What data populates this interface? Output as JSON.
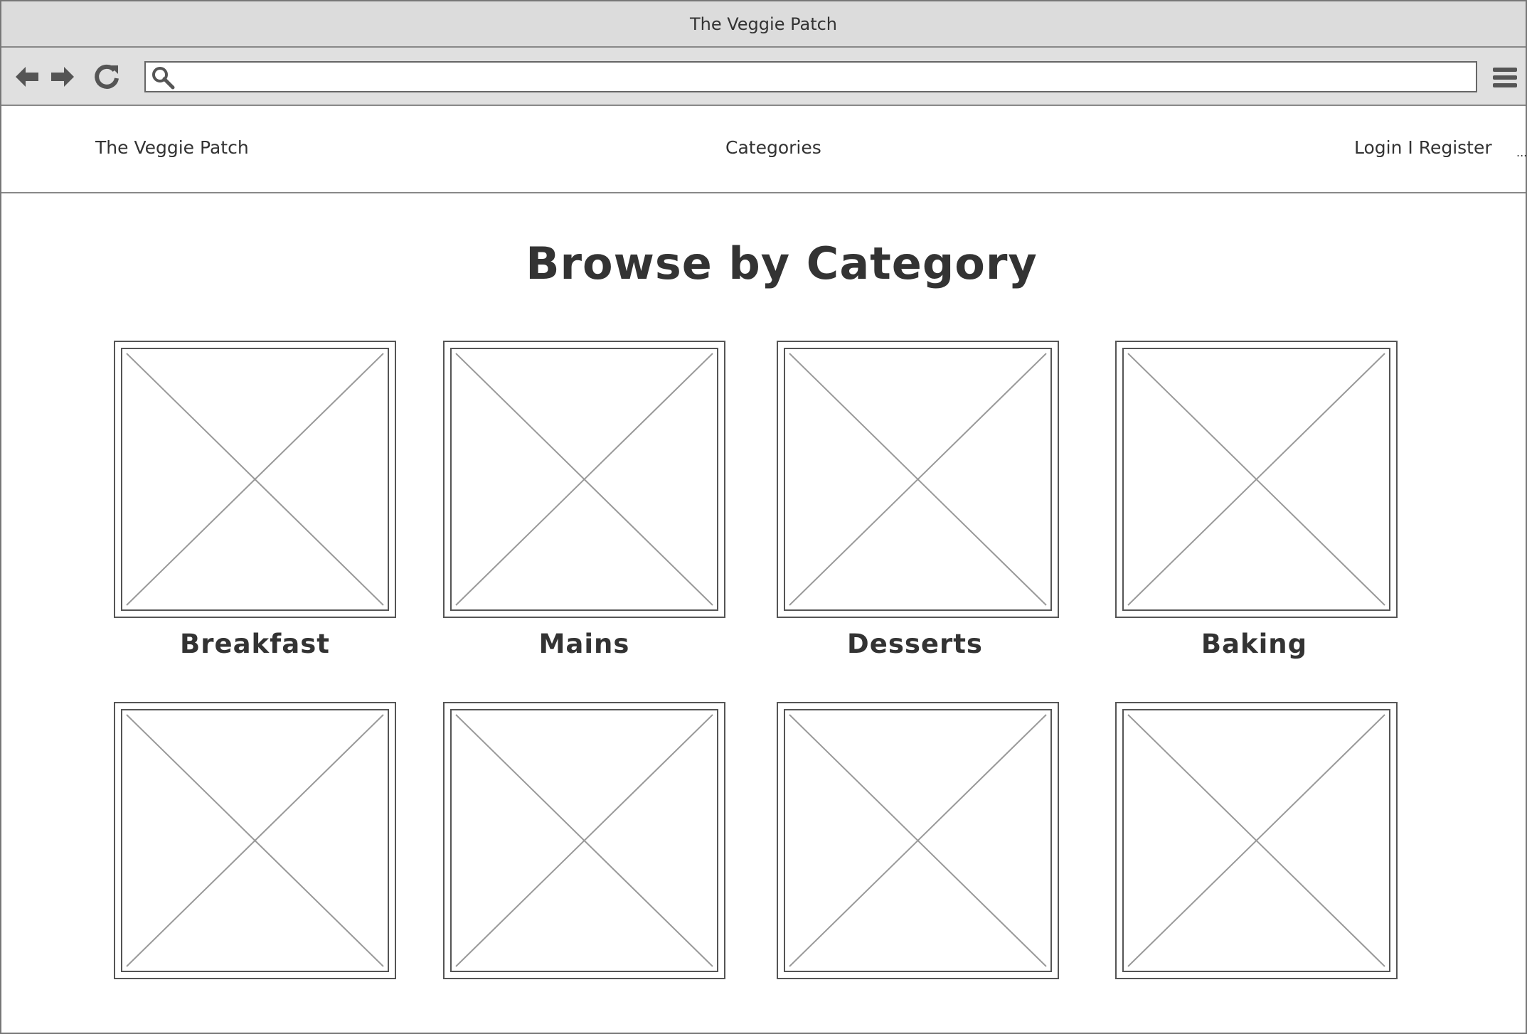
{
  "window": {
    "title": "The Veggie Patch"
  },
  "toolbar": {
    "address_value": "",
    "icons": [
      "back-arrow-icon",
      "forward-arrow-icon",
      "reload-icon",
      "search-icon",
      "hamburger-menu-icon"
    ]
  },
  "header": {
    "brand": "The Veggie Patch",
    "categories": "Categories",
    "auth": "Login I Register",
    "more": "..."
  },
  "main": {
    "title": "Browse by Category",
    "categories": [
      {
        "label": "Breakfast"
      },
      {
        "label": "Mains"
      },
      {
        "label": "Desserts"
      },
      {
        "label": "Baking"
      },
      {
        "label": ""
      },
      {
        "label": ""
      },
      {
        "label": ""
      },
      {
        "label": ""
      }
    ]
  },
  "colors": {
    "chrome": "#dcdcdc",
    "border": "#777777",
    "text": "#333333",
    "placeholder_line": "#999999"
  }
}
